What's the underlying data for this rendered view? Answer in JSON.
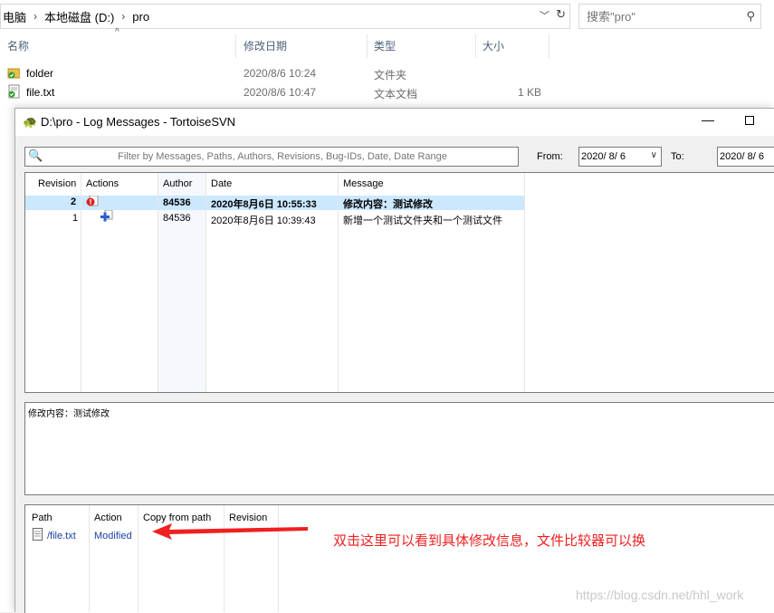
{
  "explorer": {
    "breadcrumb": [
      "电脑",
      "本地磁盘 (D:)",
      "pro"
    ],
    "search_placeholder": "搜索\"pro\"",
    "columns": [
      "名称",
      "修改日期",
      "类型",
      "大小"
    ],
    "files": [
      {
        "name": "folder",
        "date": "2020/8/6 10:24",
        "type": "文件夹",
        "size": ""
      },
      {
        "name": "file.txt",
        "date": "2020/8/6 10:47",
        "type": "文本文档",
        "size": "1 KB"
      }
    ]
  },
  "dialog": {
    "title": "D:\\pro - Log Messages - TortoiseSVN",
    "filter_placeholder": "Filter by Messages, Paths, Authors, Revisions, Bug-IDs, Date, Date Range",
    "from_label": "From:",
    "from_value": "2020/ 8/ 6",
    "to_label": "To:",
    "to_value": "2020/ 8/ 6",
    "log_columns": [
      "Revision",
      "Actions",
      "Author",
      "Date",
      "Message"
    ],
    "log_rows": [
      {
        "revision": "2",
        "author": "84536",
        "date": "2020年8月6日 10:55:33",
        "message": "修改内容：测试修改",
        "selected": true
      },
      {
        "revision": "1",
        "author": "84536",
        "date": "2020年8月6日 10:39:43",
        "message": "新增一个测试文件夹和一个测试文件",
        "selected": false
      }
    ],
    "message_text": "修改内容：测试修改",
    "path_columns": [
      "Path",
      "Action",
      "Copy from path",
      "Revision"
    ],
    "path_rows": [
      {
        "path": "/file.txt",
        "action": "Modified",
        "copy_from": "",
        "revision": ""
      }
    ]
  },
  "annotation": "双击这里可以看到具体修改信息，文件比较器可以换",
  "watermark": "https://blog.csdn.net/hhl_work",
  "colors": {
    "selection": "#cce8ff",
    "annotation": "#ef2020",
    "path_text": "#1a3ea8"
  }
}
